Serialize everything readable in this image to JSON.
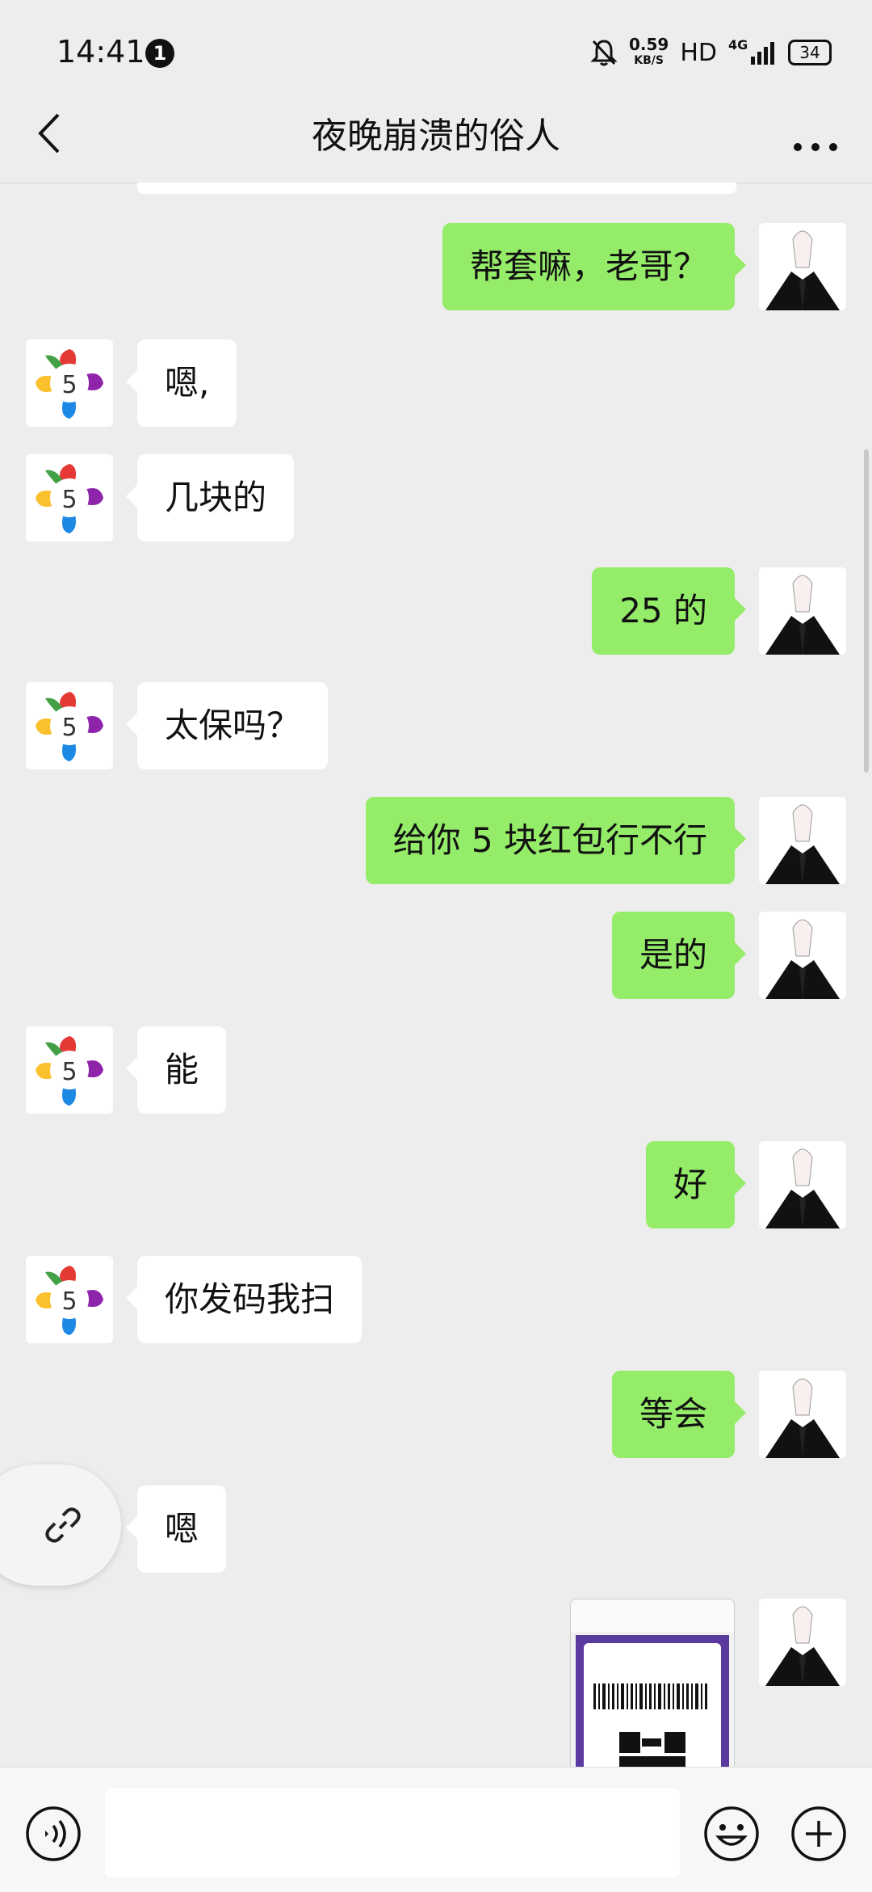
{
  "status_bar": {
    "time": "14:41",
    "notification_count": "1",
    "net_speed": "0.59",
    "net_unit": "KB/S",
    "hd_label": "HD",
    "network_type": "4G",
    "battery": "34"
  },
  "header": {
    "title": "夜晚崩溃的俗人"
  },
  "messages": [
    {
      "side": "right",
      "text": "帮套嘛，老哥？"
    },
    {
      "side": "left",
      "text": "嗯,"
    },
    {
      "side": "left",
      "text": "几块的"
    },
    {
      "side": "right",
      "text": "25 的"
    },
    {
      "side": "left",
      "text": "太保吗？"
    },
    {
      "side": "right",
      "text": "给你 5 块红包行不行"
    },
    {
      "side": "right",
      "text": "是的"
    },
    {
      "side": "left",
      "text": "能"
    },
    {
      "side": "right",
      "text": "好"
    },
    {
      "side": "left",
      "text": "你发码我扫"
    },
    {
      "side": "right",
      "text": "等会"
    },
    {
      "side": "left",
      "text": "嗯"
    }
  ],
  "contact_avatar_label": "5",
  "colors": {
    "background": "#ededed",
    "bubble_self": "#95ec69",
    "bubble_other": "#ffffff"
  },
  "input_bar": {
    "voice_icon": "voice-icon",
    "emoji_icon": "emoji-icon",
    "plus_icon": "plus-icon"
  }
}
